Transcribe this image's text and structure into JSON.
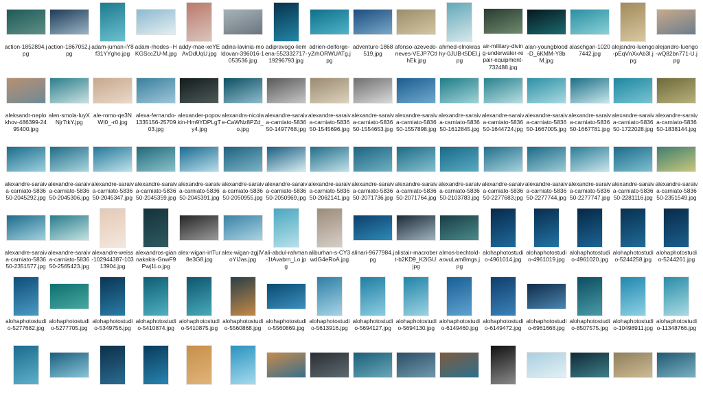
{
  "files": [
    {
      "name": "action-1852894.jpg",
      "shape": "landscape",
      "c": [
        "#1e5a57",
        "#5f8f86"
      ]
    },
    {
      "name": "action-1867052.jpg",
      "shape": "landscape",
      "c": [
        "#1e3c58",
        "#9bb3c4"
      ]
    },
    {
      "name": "adam-juman-iY8f31YYgho.jpg",
      "shape": "portrait",
      "c": [
        "#1d7a8f",
        "#6cc0cf"
      ]
    },
    {
      "name": "adam-rhodes--HKGSccZU-M.jpg",
      "shape": "landscape",
      "c": [
        "#8db9cf",
        "#e3eef2"
      ]
    },
    {
      "name": "addy-mae-xeYEAvDdUqU.jpg",
      "shape": "portrait",
      "c": [
        "#bb7a6a",
        "#d9c4bd"
      ]
    },
    {
      "name": "adina-lavinia-moldovan-396016-1053536.jpg",
      "shape": "landscape",
      "c": [
        "#a8b3b8",
        "#6b7580"
      ]
    },
    {
      "name": "adipravogo-liemena-552332717-19296793.jpg",
      "shape": "portrait",
      "c": [
        "#06324c",
        "#2486a6"
      ]
    },
    {
      "name": "adrien-delforge-yZrhORWUATg.jpg",
      "shape": "landscape",
      "c": [
        "#0f6f8a",
        "#4fb4c8"
      ]
    },
    {
      "name": "adventure-1868519.jpg",
      "shape": "landscape",
      "c": [
        "#1c4d80",
        "#78a8c8"
      ]
    },
    {
      "name": "afonso-azevedo-neves-VEJP7CtlhEk.jpg",
      "shape": "landscape",
      "c": [
        "#9a8d6a",
        "#d4c6a2"
      ]
    },
    {
      "name": "ahmed-elnokrashy-0JUB-t5DEl.jpg",
      "shape": "portrait",
      "c": [
        "#62a8b8",
        "#d5e7ea"
      ]
    },
    {
      "name": "air-military-diving-underwater-repair-equipment-732488.jpg",
      "shape": "landscape",
      "c": [
        "#2b3b32",
        "#6e8a6c"
      ]
    },
    {
      "name": "alan-youngblood-D_6KMM-Y8bM.jpg",
      "shape": "landscape",
      "c": [
        "#07171f",
        "#1a6b6e"
      ]
    },
    {
      "name": "alaschgari-10207442.jpg",
      "shape": "landscape",
      "c": [
        "#2a8fa2",
        "#8ad0d6"
      ]
    },
    {
      "name": "alejandro-luengo-pEqVnXxAb3I.jpg",
      "shape": "portrait",
      "c": [
        "#a28a5a",
        "#d8c7a1"
      ]
    },
    {
      "name": "alejandro-luengo-wQ82bn771-U.jpg",
      "shape": "landscape",
      "c": [
        "#c9a98b",
        "#6c7e8d"
      ]
    },
    {
      "name": "aleksandr-neplokhov-486399-2495400.jpg",
      "shape": "landscape",
      "c": [
        "#b89070",
        "#6f8a98"
      ]
    },
    {
      "name": "alen-smola-luyXNjr7tkY.jpg",
      "shape": "landscape",
      "c": [
        "#2c7f8c",
        "#c9e0e0"
      ]
    },
    {
      "name": "ale-romo-qe3NWI0_-r0.jpg",
      "shape": "landscape",
      "c": [
        "#c8a88d",
        "#e9d8c9"
      ]
    },
    {
      "name": "alexa-fernando-1335156-2570903.jpg",
      "shape": "landscape",
      "c": [
        "#3a7f9e",
        "#9ec6d8"
      ]
    },
    {
      "name": "alexander-popovkin-Hm9YDPLgTy4.jpg",
      "shape": "landscape",
      "c": [
        "#141b1c",
        "#4b5a57"
      ]
    },
    {
      "name": "alexandra-nicolae-CaWNz8PZd_o.jpg",
      "shape": "landscape",
      "c": [
        "#0f4f64",
        "#8dbccb"
      ]
    },
    {
      "name": "alexandre-saraiva-carniato-583650-1497768.jpg",
      "shape": "landscape",
      "c": [
        "#5a5a5a",
        "#c5c5c5"
      ]
    },
    {
      "name": "alexandre-saraiva-carniato-583650-1545696.jpg",
      "shape": "landscape",
      "c": [
        "#9a8a70",
        "#dcd2bd"
      ]
    },
    {
      "name": "alexandre-saraiva-carniato-583650-1554653.jpg",
      "shape": "landscape",
      "c": [
        "#707070",
        "#d9d9d9"
      ]
    },
    {
      "name": "alexandre-saraiva-carniato-583650-1557898.jpg",
      "shape": "landscape",
      "c": [
        "#1c5d8e",
        "#6ea8ce"
      ]
    },
    {
      "name": "alexandre-saraiva-carniato-583650-1612845.jpg",
      "shape": "landscape",
      "c": [
        "#1f7d8a",
        "#9fd2d6"
      ]
    },
    {
      "name": "alexandre-saraiva-carniato-583650-1644724.jpg",
      "shape": "landscape",
      "c": [
        "#2a8290",
        "#b7dde0"
      ]
    },
    {
      "name": "alexandre-saraiva-carniato-583650-1667005.jpg",
      "shape": "landscape",
      "c": [
        "#2d90a6",
        "#a8d8e0"
      ]
    },
    {
      "name": "alexandre-saraiva-carniato-583650-1667781.jpg",
      "shape": "landscape",
      "c": [
        "#1c6f87",
        "#c8e6ea"
      ]
    },
    {
      "name": "alexandre-saraiva-carniato-583650-1722028.jpg",
      "shape": "landscape",
      "c": [
        "#1f86a0",
        "#78c4d2"
      ]
    },
    {
      "name": "alexandre-saraiva-carniato-583650-1838144.jpg",
      "shape": "landscape",
      "c": [
        "#6d6a3a",
        "#b7b07a"
      ]
    },
    {
      "name": "alexandre-saraiva-carniato-583650-2045292.jpg",
      "shape": "landscape",
      "c": [
        "#1c6c8c",
        "#9bd0dd"
      ]
    },
    {
      "name": "alexandre-saraiva-carniato-583650-2045306.jpg",
      "shape": "landscape",
      "c": [
        "#206d87",
        "#a9d5df"
      ]
    },
    {
      "name": "alexandre-saraiva-carniato-583650-2045347.jpg",
      "shape": "landscape",
      "c": [
        "#24789a",
        "#bfe1ea"
      ]
    },
    {
      "name": "alexandre-saraiva-carniato-583650-2045359.jpg",
      "shape": "landscape",
      "c": [
        "#1f6a7a",
        "#8cc1c9"
      ]
    },
    {
      "name": "alexandre-saraiva-carniato-583650-2045391.jpg",
      "shape": "landscape",
      "c": [
        "#1a6c92",
        "#b8dcea"
      ]
    },
    {
      "name": "alexandre-saraiva-carniato-583650-2050955.jpg",
      "shape": "landscape",
      "c": [
        "#1e6280",
        "#7cb3c6"
      ]
    },
    {
      "name": "alexandre-saraiva-carniato-583650-2050969.jpg",
      "shape": "landscape",
      "c": [
        "#1a5f82",
        "#d8ecf2"
      ]
    },
    {
      "name": "alexandre-saraiva-carniato-583650-2062141.jpg",
      "shape": "landscape",
      "c": [
        "#216e8a",
        "#c2e0e8"
      ]
    },
    {
      "name": "alexandre-saraiva-carniato-583650-2071736.jpg",
      "shape": "landscape",
      "c": [
        "#1b6480",
        "#6fb0c2"
      ]
    },
    {
      "name": "alexandre-saraiva-carniato-583650-2071764.jpg",
      "shape": "landscape",
      "c": [
        "#1d6b86",
        "#84c0cf"
      ]
    },
    {
      "name": "alexandre-saraiva-carniato-583650-2103783.jpg",
      "shape": "landscape",
      "c": [
        "#186a88",
        "#5aa9c0"
      ]
    },
    {
      "name": "alexandre-saraiva-carniato-583650-2277683.jpg",
      "shape": "landscape",
      "c": [
        "#236f8c",
        "#a6d2dc"
      ]
    },
    {
      "name": "alexandre-saraiva-carniato-583650-2277744.jpg",
      "shape": "landscape",
      "c": [
        "#1d6a87",
        "#9ccad6"
      ]
    },
    {
      "name": "alexandre-saraiva-carniato-583650-2277747.jpg",
      "shape": "landscape",
      "c": [
        "#2a7d97",
        "#c9e4ea"
      ]
    },
    {
      "name": "alexandre-saraiva-carniato-583650-2281116.jpg",
      "shape": "landscape",
      "c": [
        "#1c6b8a",
        "#7ebfd0"
      ]
    },
    {
      "name": "alexandre-saraiva-carniato-583650-2351549.jpg",
      "shape": "landscape",
      "c": [
        "#3f7f6e",
        "#c8c77e"
      ]
    },
    {
      "name": "alexandre-saraiva-carniato-583650-2351577.jpg",
      "shape": "landscape",
      "c": [
        "#1e6b8b",
        "#a1d1df"
      ]
    },
    {
      "name": "alexandre-saraiva-carniato-583650-2565423.jpg",
      "shape": "landscape",
      "c": [
        "#2a7c8c",
        "#c3e2e2"
      ]
    },
    {
      "name": "alexandre-weiss-102944387-10313904.jpg",
      "shape": "portrait",
      "c": [
        "#e4c9b6",
        "#f4e7dd"
      ]
    },
    {
      "name": "alexandros-giannakakis-GnwF9Pwj1Lo.jpg",
      "shape": "portrait",
      "c": [
        "#16323a",
        "#2d5a60"
      ]
    },
    {
      "name": "alex-wigan-irITur8e3G8.jpg",
      "shape": "landscape",
      "c": [
        "#262626",
        "#9a9a9a"
      ]
    },
    {
      "name": "alex-wigan-zgjIVoYIJas.jpg",
      "shape": "landscape",
      "c": [
        "#3b82a4",
        "#a9d3e4"
      ]
    },
    {
      "name": "ali-abdul-rahman-1tAvabrn_Lo.jpg",
      "shape": "portrait",
      "c": [
        "#4aa7c0",
        "#b7e1ea"
      ]
    },
    {
      "name": "aliburhan-s-CY3wdG4eRoA.jpg",
      "shape": "portrait",
      "c": [
        "#9c8b7a",
        "#d6cfc7"
      ]
    },
    {
      "name": "alinari-9677984.jpg",
      "shape": "landscape",
      "c": [
        "#0d3f6a",
        "#2d8ab8"
      ]
    },
    {
      "name": "alistair-macrobert-b2KD9_K2iGU.jpg",
      "shape": "landscape",
      "c": [
        "#1b2b38",
        "#a0b2bd"
      ]
    },
    {
      "name": "almos-bechtold-aovuLam8mgs.jpg",
      "shape": "landscape",
      "c": [
        "#173d44",
        "#4c8a8b"
      ]
    },
    {
      "name": "alohaphotostudio-4961014.jpg",
      "shape": "portrait",
      "c": [
        "#07294a",
        "#1e6a9c"
      ]
    },
    {
      "name": "alohaphotostudio-4961019.jpg",
      "shape": "portrait",
      "c": [
        "#082c4c",
        "#2274a5"
      ]
    },
    {
      "name": "alohaphotostudio-4961020.jpg",
      "shape": "portrait",
      "c": [
        "#062744",
        "#1c6494"
      ]
    },
    {
      "name": "alohaphotostudio-5244258.jpg",
      "shape": "portrait",
      "c": [
        "#07304f",
        "#206b98"
      ]
    },
    {
      "name": "alohaphotostudio-5244261.jpg",
      "shape": "portrait",
      "c": [
        "#072a47",
        "#1b5f8d"
      ]
    },
    {
      "name": "alohaphotostudio-5277682.jpg",
      "shape": "portrait",
      "c": [
        "#0e4e78",
        "#4a9ac4"
      ]
    },
    {
      "name": "alohaphotostudio-5277705.jpg",
      "shape": "landscape",
      "c": [
        "#0f6f6f",
        "#47a8a0"
      ]
    },
    {
      "name": "alohaphotostudio-5349756.jpg",
      "shape": "portrait",
      "c": [
        "#0a3553",
        "#2a7ba6"
      ]
    },
    {
      "name": "alohaphotostudio-5410874.jpg",
      "shape": "portrait",
      "c": [
        "#0e5d72",
        "#4fb1c1"
      ]
    },
    {
      "name": "alohaphotostudio-5410875.jpg",
      "shape": "portrait",
      "c": [
        "#0c566d",
        "#49a9bb"
      ]
    },
    {
      "name": "alohaphotostudio-5560868.jpg",
      "shape": "portrait",
      "c": [
        "#2a3f45",
        "#c48a4a"
      ]
    },
    {
      "name": "alohaphotostudio-5560869.jpg",
      "shape": "landscape",
      "c": [
        "#0b4a70",
        "#3b8fbf"
      ]
    },
    {
      "name": "alohaphotostudio-5613916.jpg",
      "shape": "portrait",
      "c": [
        "#2f7fa6",
        "#a7d4e6"
      ]
    },
    {
      "name": "alohaphotostudio-5694127.jpg",
      "shape": "portrait",
      "c": [
        "#1f7ea4",
        "#8ccde0"
      ]
    },
    {
      "name": "alohaphotostudio-5694130.jpg",
      "shape": "portrait",
      "c": [
        "#2384a8",
        "#9ad3e3"
      ]
    },
    {
      "name": "alohaphotostudio-6149460.jpg",
      "shape": "portrait",
      "c": [
        "#1a5f95",
        "#5ea3cf"
      ]
    },
    {
      "name": "alohaphotostudio-6149472.jpg",
      "shape": "portrait",
      "c": [
        "#0f3d6c",
        "#3b83b8"
      ]
    },
    {
      "name": "alohaphotostudio-6961668.jpg",
      "shape": "landscape",
      "c": [
        "#102c4a",
        "#4b85b0"
      ]
    },
    {
      "name": "alohaphotostudio-8507575.jpg",
      "shape": "portrait",
      "c": [
        "#0c4e62",
        "#4a9aa6"
      ]
    },
    {
      "name": "alohaphotostudio-10498911.jpg",
      "shape": "portrait",
      "c": [
        "#1f88b0",
        "#8fd0e4"
      ]
    },
    {
      "name": "alohaphotostudio-11348766.jpg",
      "shape": "portrait",
      "c": [
        "#2a8ca6",
        "#a9dbe4"
      ]
    },
    {
      "name": "",
      "shape": "portrait",
      "c": [
        "#1b6c8e",
        "#5eb0c9"
      ]
    },
    {
      "name": "",
      "shape": "landscape",
      "c": [
        "#1a5f7e",
        "#8ac4d8"
      ]
    },
    {
      "name": "",
      "shape": "portrait",
      "c": [
        "#0c2f48",
        "#2b6b90"
      ]
    },
    {
      "name": "",
      "shape": "portrait",
      "c": [
        "#0a3a5a",
        "#2884b0"
      ]
    },
    {
      "name": "",
      "shape": "portrait",
      "c": [
        "#c7904a",
        "#e0b47a"
      ]
    },
    {
      "name": "",
      "shape": "portrait",
      "c": [
        "#2a93bf",
        "#a6daee"
      ]
    },
    {
      "name": "",
      "shape": "landscape",
      "c": [
        "#c68a4a",
        "#3a6f8e"
      ]
    },
    {
      "name": "",
      "shape": "landscape",
      "c": [
        "#2a2f33",
        "#5d6a70"
      ]
    },
    {
      "name": "",
      "shape": "landscape",
      "c": [
        "#1b5f78",
        "#68a7b9"
      ]
    },
    {
      "name": "",
      "shape": "landscape",
      "c": [
        "#2c4f66",
        "#6f98ad"
      ]
    },
    {
      "name": "",
      "shape": "landscape",
      "c": [
        "#7d5b3f",
        "#2d6f8e"
      ]
    },
    {
      "name": "",
      "shape": "portrait",
      "c": [
        "#111111",
        "#8a8a8a"
      ]
    },
    {
      "name": "",
      "shape": "landscape",
      "c": [
        "#a9cfe0",
        "#e3f0f5"
      ]
    },
    {
      "name": "",
      "shape": "landscape",
      "c": [
        "#0f2a35",
        "#3f7f8a"
      ]
    },
    {
      "name": "",
      "shape": "landscape",
      "c": [
        "#8f7f5c",
        "#cdbb93"
      ]
    },
    {
      "name": "",
      "shape": "landscape",
      "c": [
        "#1f5a72",
        "#7bb0c2"
      ]
    }
  ]
}
